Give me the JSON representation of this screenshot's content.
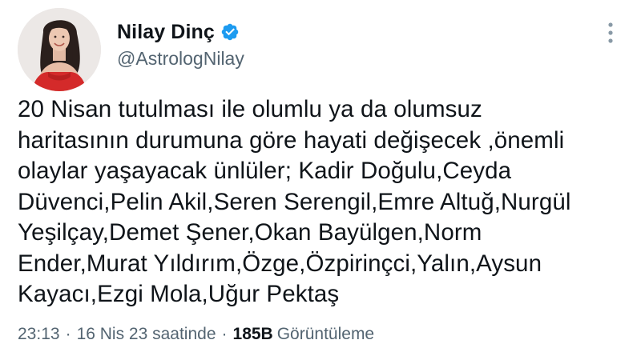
{
  "author": {
    "display_name": "Nilay Dinç",
    "handle": "@AstrologNilay",
    "verified": true,
    "verified_color": "#1d9bf0"
  },
  "tweet": {
    "text": "20 Nisan tutulması ile olumlu ya da olumsuz\nharitasının durumuna göre hayati değişecek ,önemli\nolaylar yaşayacak ünlüler; Kadir Doğulu,Ceyda\nDüvenci,Pelin Akil,Seren Serengil,Emre Altuğ,Nurgül\nYeşilçay,Demet Şener,Okan Bayülgen,Norm\nEnder,Murat Yıldırım,Özge,Özpirinçci,Yalın,Aysun\nKayacı,Ezgi Mola,Uğur Pektaş"
  },
  "meta": {
    "time": "23:13",
    "separator": "·",
    "date": "16 Nis 23 saatinde",
    "views_count": "185B",
    "views_label": "Görüntüleme"
  },
  "icons": {
    "more": "more-vertical-icon",
    "verified": "verified-badge-icon"
  },
  "colors": {
    "text_primary": "#0f1419",
    "text_secondary": "#536471",
    "more_icon": "#8899a6"
  }
}
